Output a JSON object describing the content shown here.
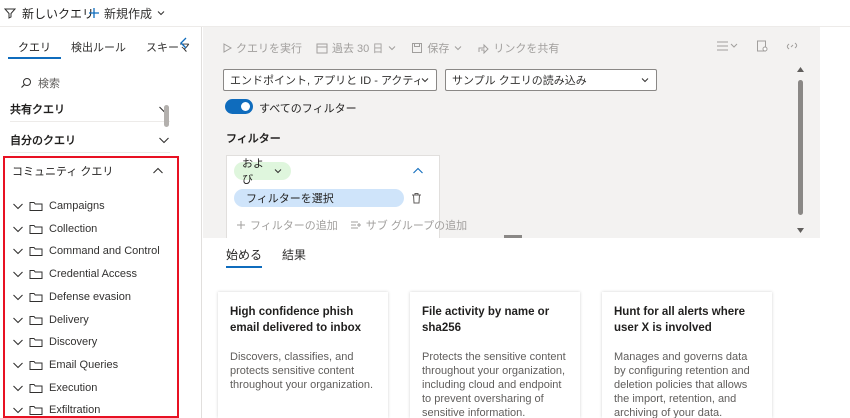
{
  "topbar": {
    "tab_label": "新しいクエリ",
    "new_label": "新規作成"
  },
  "left": {
    "tabs": [
      "クエリ",
      "検出ルール",
      "スキーマ"
    ],
    "search_placeholder": "検索",
    "sections": {
      "shared": "共有クエリ",
      "mine": "自分のクエリ",
      "community": "コミュニティ クエリ"
    },
    "community_items": [
      "Campaigns",
      "Collection",
      "Command and Control",
      "Credential Access",
      "Defense evasion",
      "Delivery",
      "Discovery",
      "Email Queries",
      "Execution",
      "Exfiltration"
    ]
  },
  "toolbar": {
    "run": "クエリを実行",
    "range": "過去 30 日",
    "save": "保存",
    "share": "リンクを共有"
  },
  "query": {
    "source_dropdown": "エンドポイント, アプリと ID - アクティビティログ,...",
    "sample_dropdown": "サンプル クエリの読み込み",
    "all_filters": "すべてのフィルター",
    "filter_heading": "フィルター",
    "and_label": "および",
    "select_filter": "フィルターを選択",
    "add_filter": "フィルターの追加",
    "add_subgroup": "サブ グループの追加"
  },
  "results": {
    "tabs": [
      "始める",
      "結果"
    ],
    "cards": [
      {
        "title": "High confidence phish email delivered to inbox",
        "desc": "Discovers, classifies, and protects sensitive content throughout your organization."
      },
      {
        "title": "File activity by name or sha256",
        "desc": "Protects the sensitive content throughout your organization, including cloud and endpoint to prevent oversharing of sensitive information."
      },
      {
        "title": "Hunt for all alerts where user X is involved",
        "desc": "Manages and governs data by configuring retention and deletion policies that allows the import, retention, and archiving of your data."
      }
    ]
  },
  "colors": {
    "accent": "#0f6cbd",
    "highlight_box": "#e81123",
    "and_pill": "#dff6dd",
    "select_pill": "#cfe4fa"
  }
}
